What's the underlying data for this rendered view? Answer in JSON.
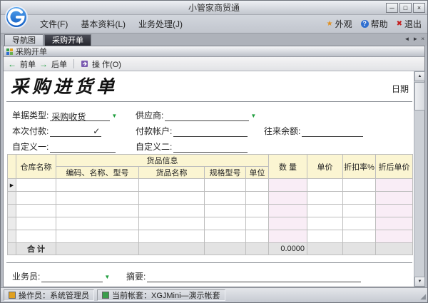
{
  "window": {
    "title": "小管家商贸通"
  },
  "icons": {
    "minimize": "─",
    "maximize": "□",
    "close": "×",
    "appearance_star": "★",
    "help_q": "?",
    "exit_x": "✖",
    "prev_arrow": "←",
    "next_arrow": "→",
    "dropdown": "▼",
    "check": "✓",
    "row_marker": "▶",
    "tab_left": "◄",
    "tab_right": "►",
    "tab_close": "×",
    "scroll_up": "▲",
    "scroll_down": "▼",
    "resize_grip": "◢"
  },
  "menubar": {
    "items": [
      {
        "label": "文件(F)"
      },
      {
        "label": "基本资料(L)"
      },
      {
        "label": "业务处理(J)"
      }
    ],
    "right": {
      "appearance": "外观",
      "help": "帮助",
      "exit": "退出"
    }
  },
  "tabs": {
    "nav": "导航图",
    "purchase": "采购开单"
  },
  "panel": {
    "title": "采购开单"
  },
  "toolbar": {
    "prev": "前单",
    "next": "后单",
    "operate": "操 作(O)"
  },
  "form": {
    "title": "采购进货单",
    "date_label": "日期",
    "doc_type_label": "单据类型:",
    "doc_type_value": "采购收货",
    "supplier_label": "供应商:",
    "payment_label": "本次付款:",
    "account_label": "付款帐户:",
    "balance_label": "往来余额:",
    "custom1_label": "自定义一:",
    "custom2_label": "自定义二:",
    "salesman_label": "业务员:",
    "summary_label": "摘要:"
  },
  "grid": {
    "headers": {
      "warehouse": "仓库名称",
      "goods_info": "货品信息",
      "code": "编码、名称、型号",
      "name": "货品名称",
      "spec": "规格型号",
      "unit": "单位",
      "qty": "数 量",
      "price": "单价",
      "discount": "折扣率%",
      "final_price": "折后单价"
    },
    "total_label": "合 计",
    "total_qty": "0.0000"
  },
  "statusbar": {
    "operator": "操作员：系统管理员",
    "account": "当前帐套：XGJMini—演示帐套"
  }
}
